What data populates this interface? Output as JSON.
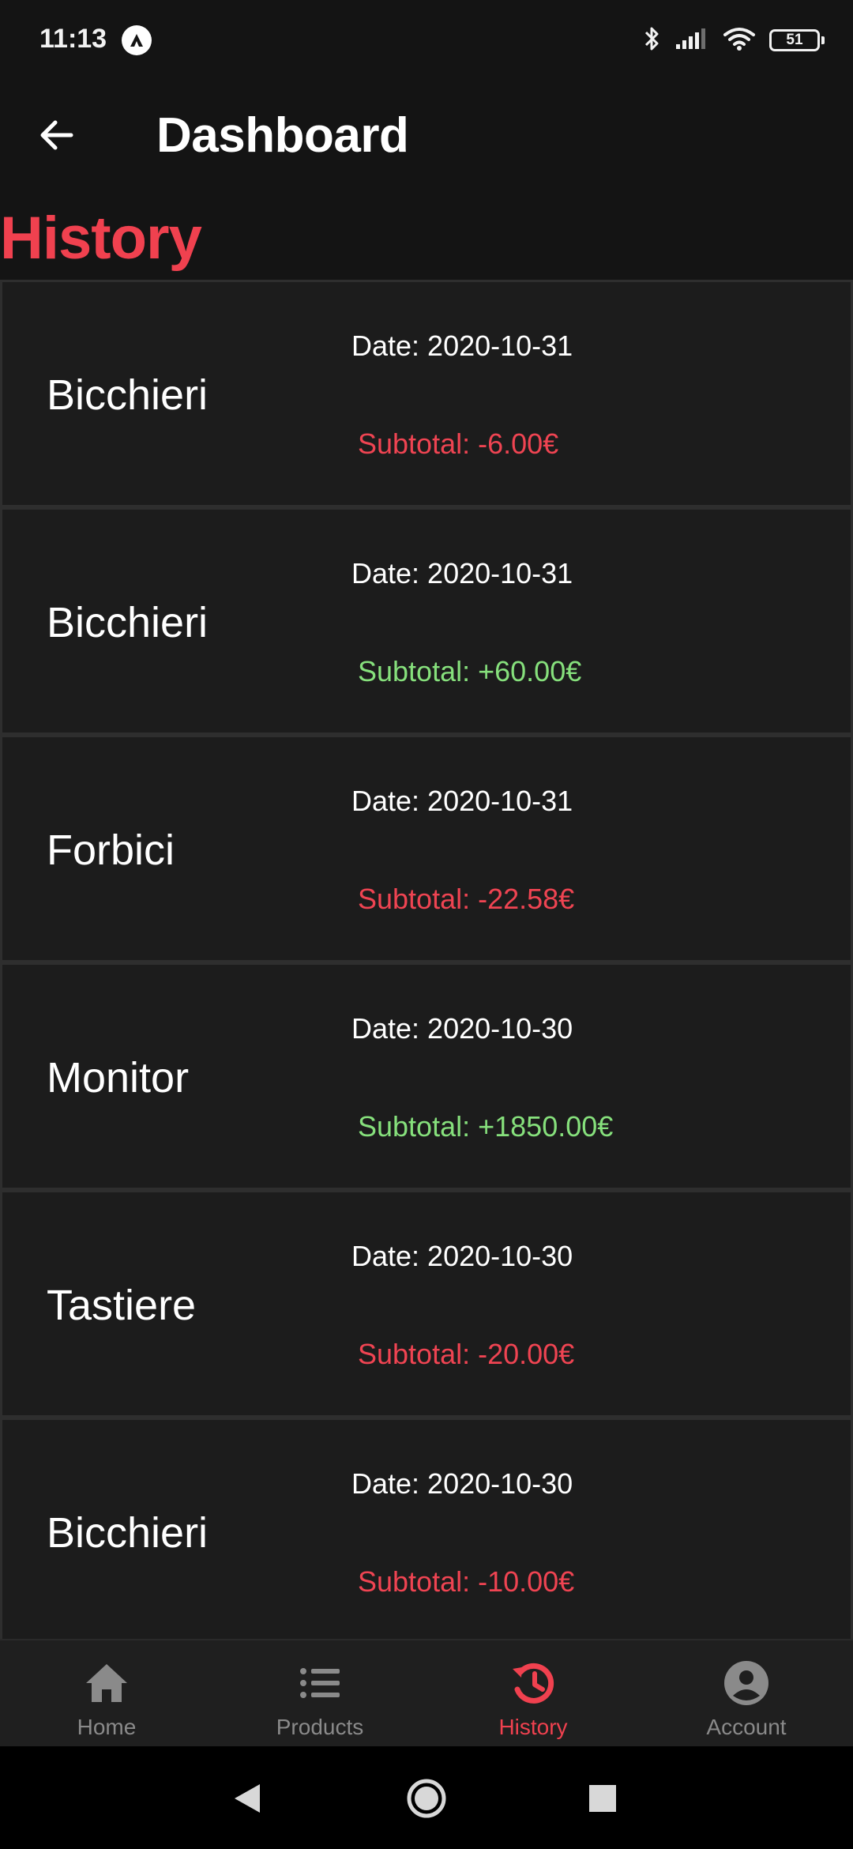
{
  "status_bar": {
    "time": "11:13",
    "battery": "51"
  },
  "app_bar": {
    "title": "Dashboard"
  },
  "section": {
    "title": "History"
  },
  "history": [
    {
      "name": "Bicchieri",
      "date": "Date: 2020-10-31",
      "subtotal": "Subtotal: -6.00€",
      "sign": "negative"
    },
    {
      "name": "Bicchieri",
      "date": "Date: 2020-10-31",
      "subtotal": "Subtotal: +60.00€",
      "sign": "positive"
    },
    {
      "name": "Forbici",
      "date": "Date: 2020-10-31",
      "subtotal": "Subtotal: -22.58€",
      "sign": "negative"
    },
    {
      "name": "Monitor",
      "date": "Date: 2020-10-30",
      "subtotal": "Subtotal: +1850.00€",
      "sign": "positive"
    },
    {
      "name": "Tastiere",
      "date": "Date: 2020-10-30",
      "subtotal": "Subtotal: -20.00€",
      "sign": "negative"
    },
    {
      "name": "Bicchieri",
      "date": "Date: 2020-10-30",
      "subtotal": "Subtotal: -10.00€",
      "sign": "negative"
    }
  ],
  "bottom_nav": {
    "items": [
      {
        "label": "Home",
        "icon": "home-icon",
        "active": false
      },
      {
        "label": "Products",
        "icon": "list-icon",
        "active": false
      },
      {
        "label": "History",
        "icon": "history-icon",
        "active": true
      },
      {
        "label": "Account",
        "icon": "account-icon",
        "active": false
      }
    ]
  },
  "colors": {
    "accent": "#f0414f",
    "negative": "#ef4452",
    "positive": "#86e07c",
    "background": "#141414",
    "card": "#1c1c1c",
    "nav_inactive": "#8a8a8a"
  }
}
